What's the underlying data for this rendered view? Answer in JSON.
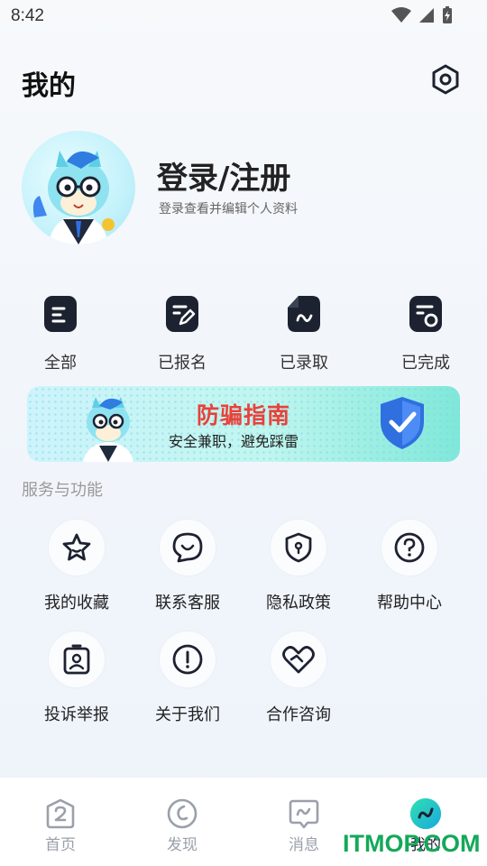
{
  "status_bar": {
    "time": "8:42"
  },
  "header": {
    "title": "我的"
  },
  "profile": {
    "login_title": "登录/注册",
    "login_subtitle": "登录查看并编辑个人资料"
  },
  "orders": [
    {
      "label": "全部",
      "icon": "clipboard-icon"
    },
    {
      "label": "已报名",
      "icon": "edit-document-icon"
    },
    {
      "label": "已录取",
      "icon": "folded-document-icon"
    },
    {
      "label": "已完成",
      "icon": "completed-document-icon"
    }
  ],
  "banner": {
    "title": "防骗指南",
    "subtitle": "安全兼职，避免踩雷"
  },
  "services": {
    "section_title": "服务与功能",
    "items": [
      {
        "label": "我的收藏",
        "icon": "star-icon"
      },
      {
        "label": "联系客服",
        "icon": "chat-bubble-icon"
      },
      {
        "label": "隐私政策",
        "icon": "shield-icon"
      },
      {
        "label": "帮助中心",
        "icon": "question-icon"
      },
      {
        "label": "投诉举报",
        "icon": "badge-icon"
      },
      {
        "label": "关于我们",
        "icon": "exclamation-icon"
      },
      {
        "label": "合作咨询",
        "icon": "handshake-heart-icon"
      }
    ]
  },
  "tabbar": {
    "items": [
      {
        "label": "首页",
        "icon": "home-icon"
      },
      {
        "label": "发现",
        "icon": "discover-icon"
      },
      {
        "label": "消息",
        "icon": "message-icon"
      },
      {
        "label": "我的",
        "icon": "profile-icon",
        "active": true
      }
    ]
  },
  "watermark": "ITMOP.COM",
  "colors": {
    "accent": "#1fc9b8",
    "banner_title": "#e8423b",
    "icon_dark": "#1c2230"
  }
}
